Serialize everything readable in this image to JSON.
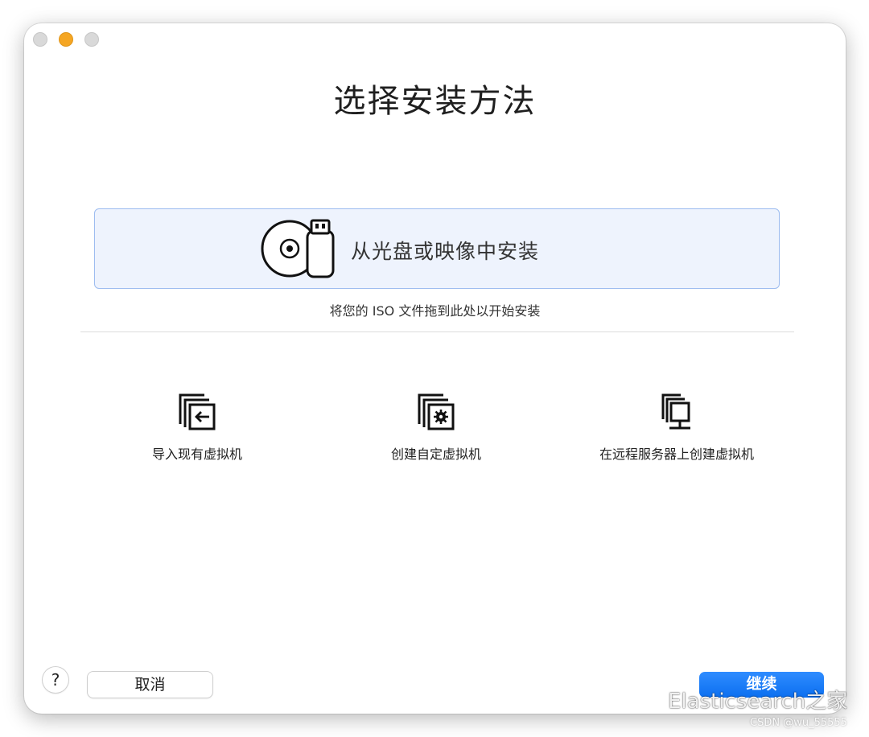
{
  "window": {
    "title": "选择安装方法"
  },
  "disc_option": {
    "label": "从光盘或映像中安装",
    "hint": "将您的 ISO 文件拖到此处以开始安装",
    "icon": "disc-usb-icon"
  },
  "options": [
    {
      "label": "导入现有虚拟机",
      "icon": "import-vm-icon"
    },
    {
      "label": "创建自定虚拟机",
      "icon": "custom-vm-icon"
    },
    {
      "label": "在远程服务器上创建虚拟机",
      "icon": "remote-server-icon"
    }
  ],
  "footer": {
    "help_label": "?",
    "cancel_label": "取消",
    "continue_label": "继续"
  },
  "watermark": {
    "text": "Elasticsearch之家",
    "sub": "CSDN @wu_55555"
  },
  "colors": {
    "accent": "#0b6ff0",
    "selection_bg": "#eef3fd",
    "selection_border": "#9dbcf0",
    "minimize": "#f5a623"
  }
}
